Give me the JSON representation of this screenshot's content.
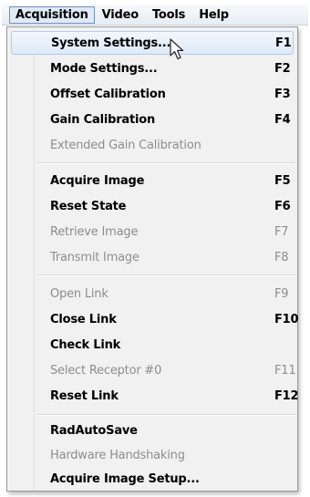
{
  "menubar": {
    "items": [
      {
        "label": "Acquisition"
      },
      {
        "label": "Video"
      },
      {
        "label": "Tools"
      },
      {
        "label": "Help"
      }
    ]
  },
  "menu": {
    "items": [
      {
        "label": "System Settings...",
        "shortcut": "F1",
        "enabled": true,
        "highlighted": true
      },
      {
        "label": "Mode Settings...",
        "shortcut": "F2",
        "enabled": true
      },
      {
        "label": "Offset Calibration",
        "shortcut": "F3",
        "enabled": true
      },
      {
        "label": "Gain Calibration",
        "shortcut": "F4",
        "enabled": true
      },
      {
        "label": "Extended Gain Calibration",
        "shortcut": "",
        "enabled": false
      },
      {
        "label": "Acquire Image",
        "shortcut": "F5",
        "enabled": true
      },
      {
        "label": "Reset State",
        "shortcut": "F6",
        "enabled": true
      },
      {
        "label": "Retrieve Image",
        "shortcut": "F7",
        "enabled": false
      },
      {
        "label": "Transmit Image",
        "shortcut": "F8",
        "enabled": false
      },
      {
        "label": "Open Link",
        "shortcut": "F9",
        "enabled": false
      },
      {
        "label": "Close Link",
        "shortcut": "F10",
        "enabled": true
      },
      {
        "label": "Check Link",
        "shortcut": "",
        "enabled": true
      },
      {
        "label": "Select Receptor #0",
        "shortcut": "F11",
        "enabled": false
      },
      {
        "label": "Reset Link",
        "shortcut": "F12",
        "enabled": true
      },
      {
        "label": "RadAutoSave",
        "shortcut": "",
        "enabled": true
      },
      {
        "label": "Hardware Handshaking",
        "shortcut": "",
        "enabled": false
      },
      {
        "label": "Acquire Image Setup...",
        "shortcut": "",
        "enabled": true
      }
    ]
  },
  "icons": {
    "cursor": "mouse-pointer-icon"
  }
}
